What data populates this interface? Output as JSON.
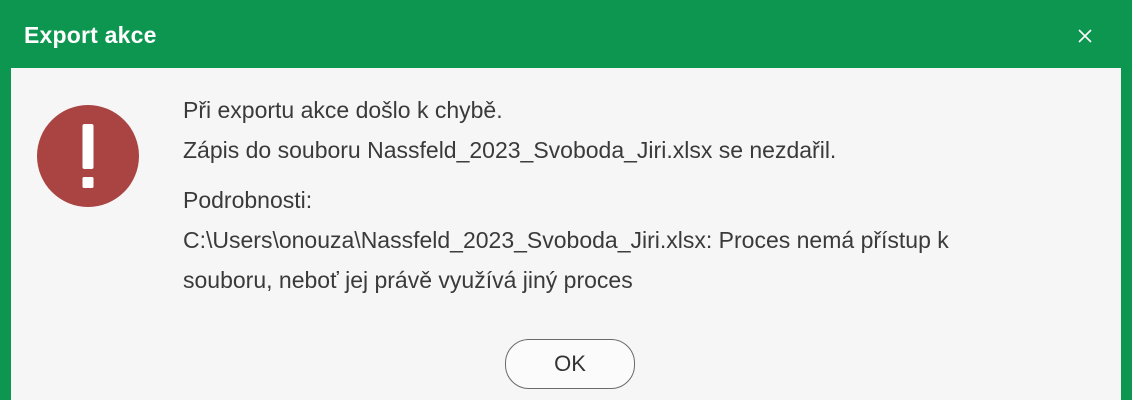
{
  "dialog": {
    "title": "Export akce",
    "close_icon": "close-icon",
    "icon": "error-icon",
    "message_line1": "Při exportu akce došlo k chybě.",
    "message_line2": "Zápis do souboru Nassfeld_2023_Svoboda_Jiri.xlsx se nezdařil.",
    "details_label": "Podrobnosti:",
    "details_line1": "C:\\Users\\onouza\\Nassfeld_2023_Svoboda_Jiri.xlsx: Proces nemá přístup k",
    "details_line2": "souboru, neboť jej právě využívá jiný proces",
    "ok_label": "OK"
  },
  "colors": {
    "title_bar": "#0c9650",
    "error_icon": "#a94442",
    "background": "#f6f6f6"
  }
}
